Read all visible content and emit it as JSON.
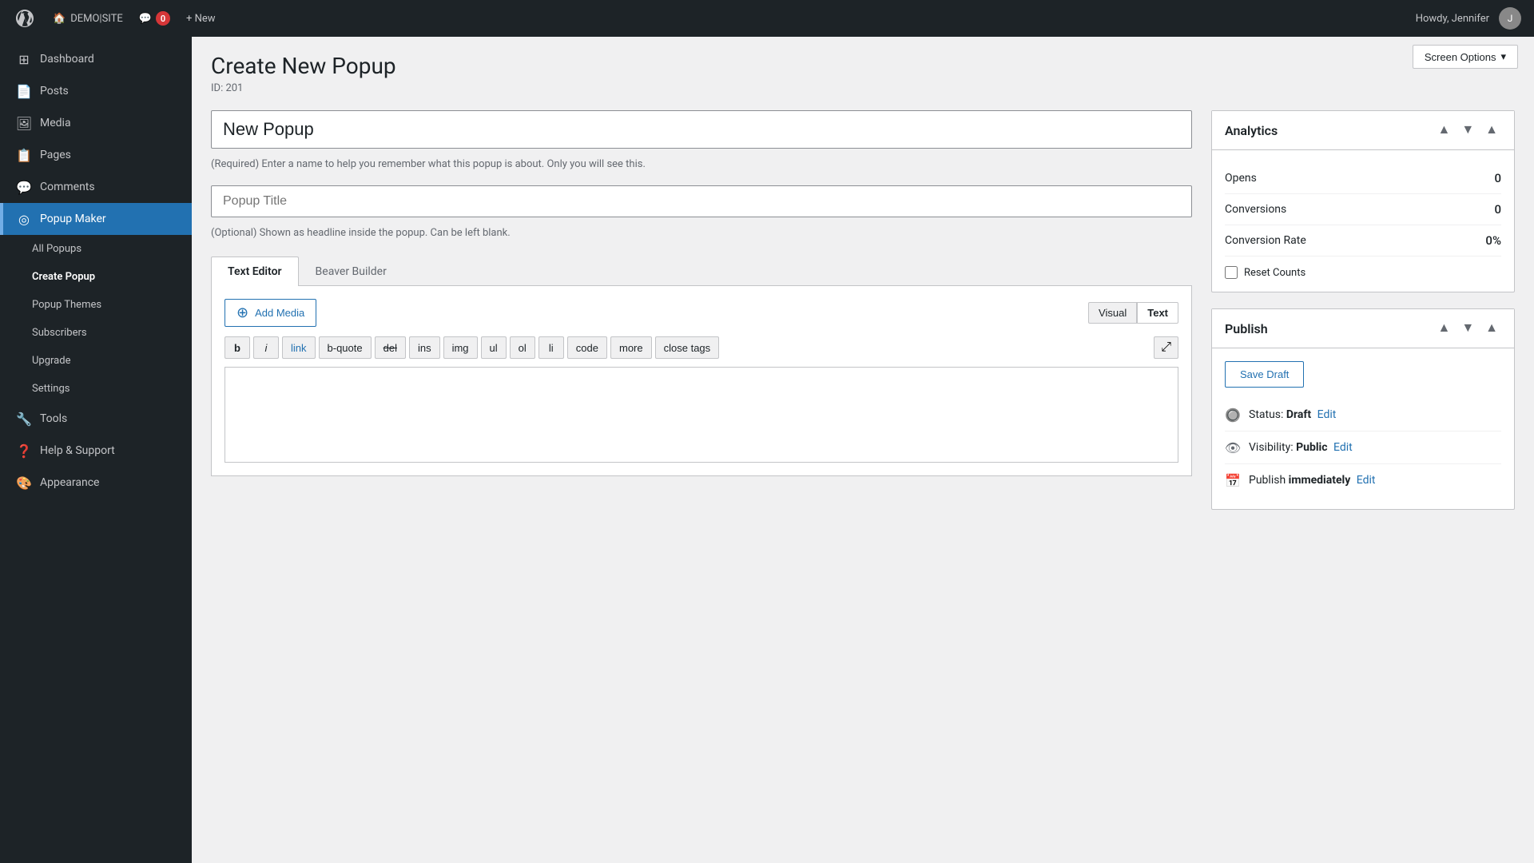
{
  "adminBar": {
    "wpLogoAlt": "WordPress",
    "siteName": "DEMO|SITE",
    "commentsCount": "0",
    "newLabel": "+ New",
    "howdy": "Howdy, Jennifer",
    "avatarInitial": "J"
  },
  "screenOptions": {
    "label": "Screen Options",
    "chevron": "▾"
  },
  "sidebar": {
    "items": [
      {
        "id": "dashboard",
        "label": "Dashboard",
        "icon": "⊞"
      },
      {
        "id": "posts",
        "label": "Posts",
        "icon": "📄"
      },
      {
        "id": "media",
        "label": "Media",
        "icon": "🖼"
      },
      {
        "id": "pages",
        "label": "Pages",
        "icon": "📋"
      },
      {
        "id": "comments",
        "label": "Comments",
        "icon": "💬"
      },
      {
        "id": "popup-maker",
        "label": "Popup Maker",
        "icon": "⊙",
        "active": true
      },
      {
        "id": "all-popups",
        "label": "All Popups",
        "icon": "",
        "sub": true
      },
      {
        "id": "create-popup",
        "label": "Create Popup",
        "icon": "",
        "sub": true,
        "activeSub": true
      },
      {
        "id": "popup-themes",
        "label": "Popup Themes",
        "icon": "",
        "sub": true
      },
      {
        "id": "subscribers",
        "label": "Subscribers",
        "icon": "",
        "sub": true
      },
      {
        "id": "upgrade",
        "label": "Upgrade",
        "icon": "",
        "sub": true
      },
      {
        "id": "settings",
        "label": "Settings",
        "icon": "",
        "sub": true
      },
      {
        "id": "tools",
        "label": "Tools",
        "icon": ""
      },
      {
        "id": "help-support",
        "label": "Help & Support",
        "icon": ""
      },
      {
        "id": "appearance",
        "label": "Appearance",
        "icon": "🎨"
      }
    ]
  },
  "page": {
    "title": "Create New Popup",
    "idLabel": "ID: 201"
  },
  "form": {
    "popupNameValue": "New Popup",
    "popupNameHint": "(Required) Enter a name to help you remember what this popup is about. Only you will see this.",
    "popupTitlePlaceholder": "Popup Title",
    "popupTitleHint": "(Optional) Shown as headline inside the popup. Can be left blank."
  },
  "tabs": [
    {
      "id": "text-editor",
      "label": "Text Editor",
      "active": true
    },
    {
      "id": "beaver-builder",
      "label": "Beaver Builder",
      "active": false
    }
  ],
  "editor": {
    "addMediaLabel": "Add Media",
    "addMediaIcon": "⊕",
    "visualLabel": "Visual",
    "textLabel": "Text",
    "formatButtons": [
      {
        "id": "bold",
        "label": "b",
        "style": "bold"
      },
      {
        "id": "italic",
        "label": "i",
        "style": "italic"
      },
      {
        "id": "link",
        "label": "link",
        "style": "link"
      },
      {
        "id": "b-quote",
        "label": "b-quote",
        "style": ""
      },
      {
        "id": "del",
        "label": "del",
        "style": "strikethrough"
      },
      {
        "id": "ins",
        "label": "ins",
        "style": ""
      },
      {
        "id": "img",
        "label": "img",
        "style": ""
      },
      {
        "id": "ul",
        "label": "ul",
        "style": ""
      },
      {
        "id": "ol",
        "label": "ol",
        "style": ""
      },
      {
        "id": "li",
        "label": "li",
        "style": ""
      },
      {
        "id": "code",
        "label": "code",
        "style": ""
      },
      {
        "id": "more",
        "label": "more",
        "style": ""
      },
      {
        "id": "close-tags",
        "label": "close tags",
        "style": ""
      }
    ],
    "expandIcon": "⤢"
  },
  "analytics": {
    "title": "Analytics",
    "opens": {
      "label": "Opens",
      "value": "0"
    },
    "conversions": {
      "label": "Conversions",
      "value": "0"
    },
    "conversionRate": {
      "label": "Conversion Rate",
      "value": "0%"
    },
    "resetCountsLabel": "Reset Counts"
  },
  "publish": {
    "title": "Publish",
    "saveDraftLabel": "Save Draft",
    "status": {
      "label": "Status:",
      "value": "Draft",
      "editLabel": "Edit"
    },
    "visibility": {
      "label": "Visibility:",
      "value": "Public",
      "editLabel": "Edit"
    },
    "publishTime": {
      "label": "Publish",
      "value": "immediately",
      "editLabel": "Edit"
    }
  }
}
